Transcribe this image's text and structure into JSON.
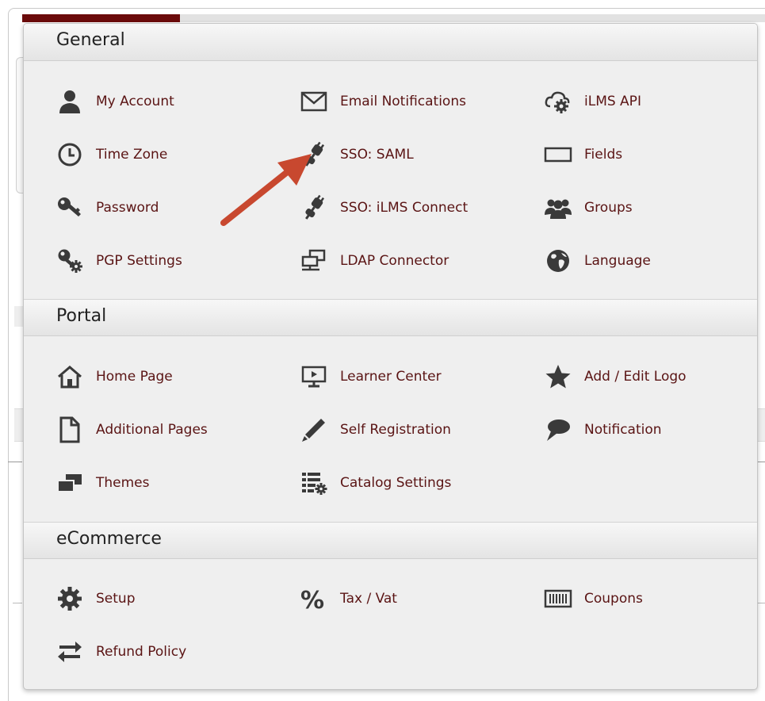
{
  "sections": [
    {
      "title": "General",
      "items": [
        {
          "label": "My Account",
          "icon": "user-icon"
        },
        {
          "label": "Email Notifications",
          "icon": "envelope-icon"
        },
        {
          "label": "iLMS API",
          "icon": "cloud-gear-icon"
        },
        {
          "label": "Time Zone",
          "icon": "clock-icon"
        },
        {
          "label": "SSO: SAML",
          "icon": "plug-icon"
        },
        {
          "label": "Fields",
          "icon": "field-box-icon"
        },
        {
          "label": "Password",
          "icon": "key-icon"
        },
        {
          "label": "SSO: iLMS Connect",
          "icon": "plug-icon"
        },
        {
          "label": "Groups",
          "icon": "group-icon"
        },
        {
          "label": "PGP Settings",
          "icon": "key-gear-icon"
        },
        {
          "label": "LDAP Connector",
          "icon": "network-icon"
        },
        {
          "label": "Language",
          "icon": "globe-icon"
        }
      ]
    },
    {
      "title": "Portal",
      "items": [
        {
          "label": "Home Page",
          "icon": "home-icon"
        },
        {
          "label": "Learner Center",
          "icon": "monitor-play-icon"
        },
        {
          "label": "Add / Edit Logo",
          "icon": "star-icon"
        },
        {
          "label": "Additional Pages",
          "icon": "page-icon"
        },
        {
          "label": "Self Registration",
          "icon": "pencil-icon"
        },
        {
          "label": "Notification",
          "icon": "chat-bubble-icon"
        },
        {
          "label": "Themes",
          "icon": "windows-icon"
        },
        {
          "label": "Catalog Settings",
          "icon": "list-gear-icon"
        }
      ]
    },
    {
      "title": "eCommerce",
      "items": [
        {
          "label": "Setup",
          "icon": "gear-icon"
        },
        {
          "label": "Tax / Vat",
          "icon": "percent-icon"
        },
        {
          "label": "Coupons",
          "icon": "barcode-icon"
        },
        {
          "label": "Refund Policy",
          "icon": "exchange-icon"
        }
      ]
    }
  ],
  "colors": {
    "link_text": "#5a1414",
    "icon": "#3a3a3a",
    "arrow": "#c8482f",
    "accent_bar": "#6b0b0b"
  }
}
